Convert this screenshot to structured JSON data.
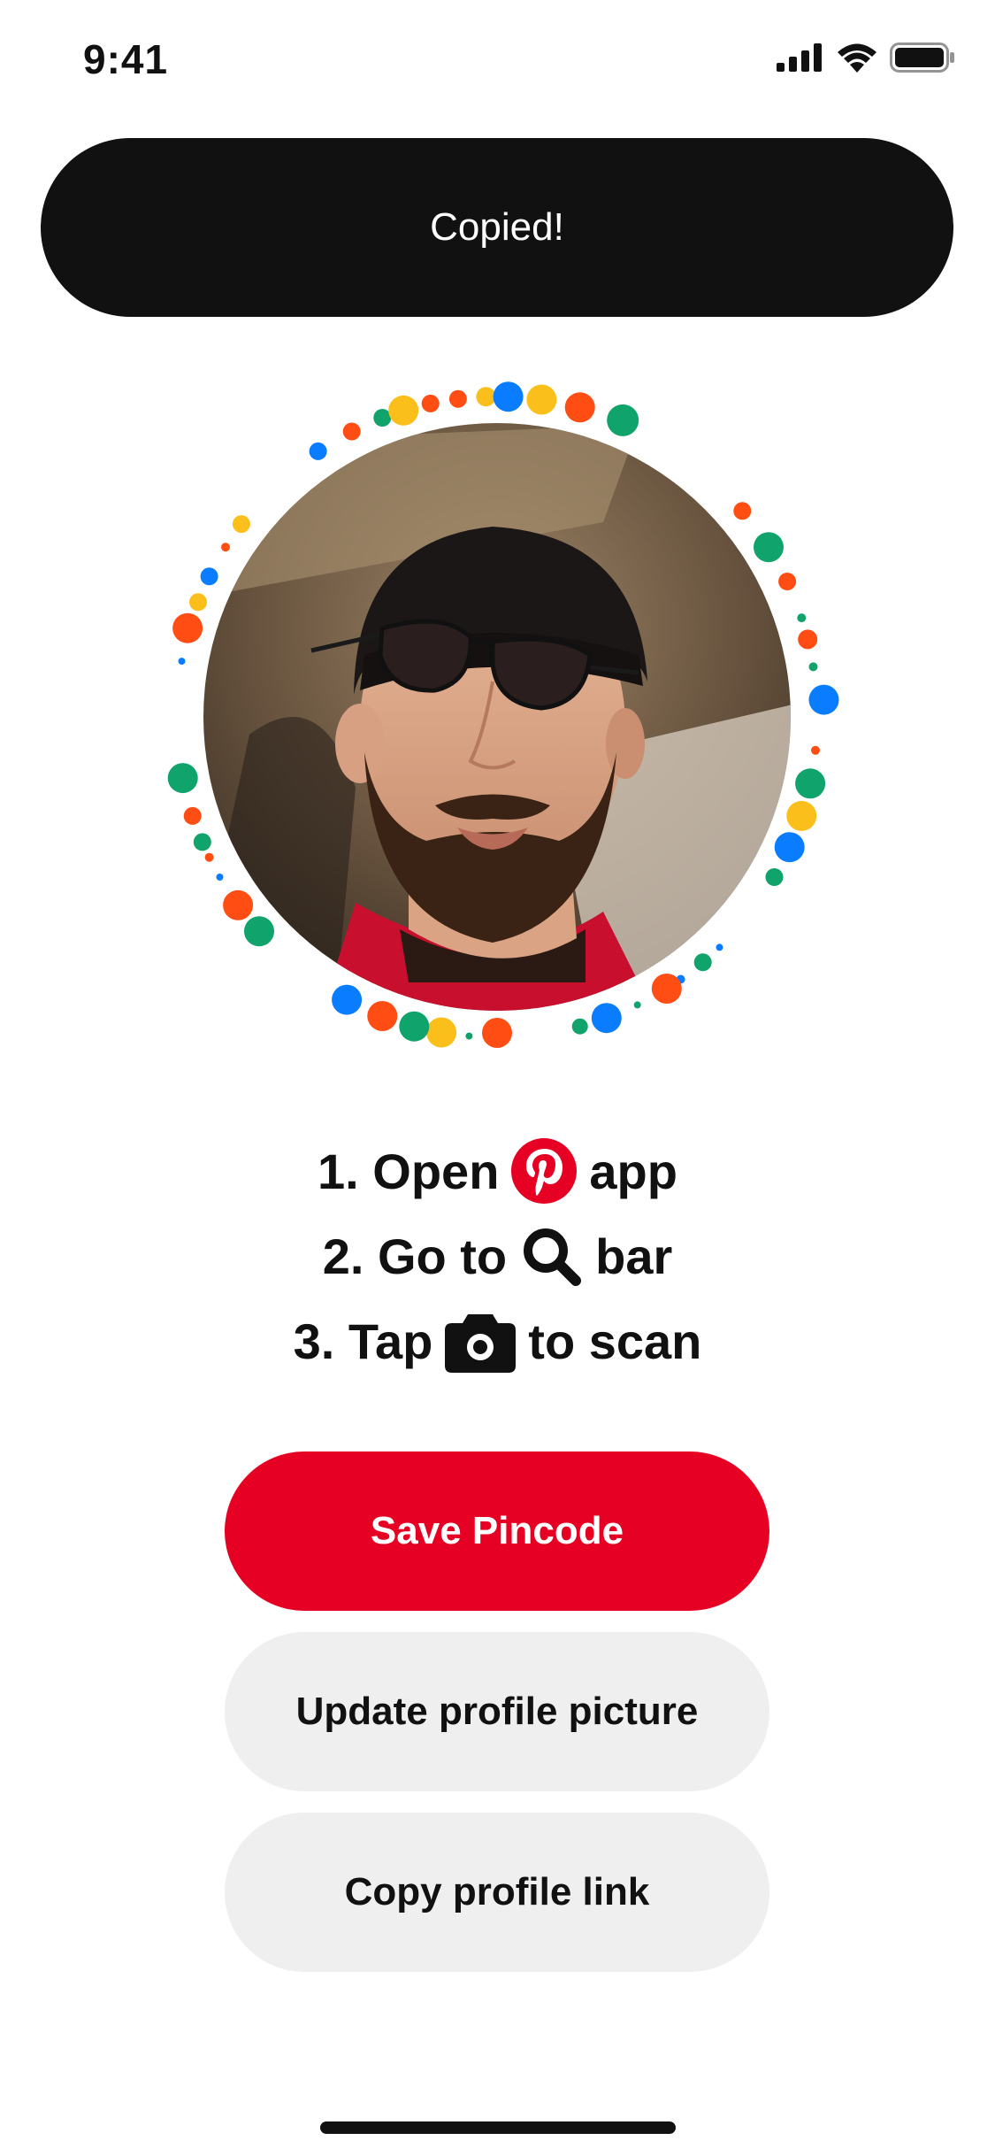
{
  "status_bar": {
    "time": "9:41"
  },
  "toast": {
    "text": "Copied!"
  },
  "instructions": {
    "step1": {
      "prefix": "1. Open",
      "icon": "pinterest-logo-icon",
      "suffix": "app"
    },
    "step2": {
      "prefix": "2. Go to",
      "icon": "search-icon",
      "suffix": "bar"
    },
    "step3": {
      "prefix": "3. Tap",
      "icon": "camera-icon",
      "suffix": "to scan"
    }
  },
  "buttons": {
    "save": "Save Pincode",
    "update": "Update profile picture",
    "copy": "Copy profile link"
  },
  "colors": {
    "brand_red": "#e60023",
    "toast_bg": "#111111",
    "secondary_button_bg": "#efefef",
    "dot_palette": [
      "#0a7cff",
      "#ff4d14",
      "#fbbf1c",
      "#10a36b"
    ]
  }
}
